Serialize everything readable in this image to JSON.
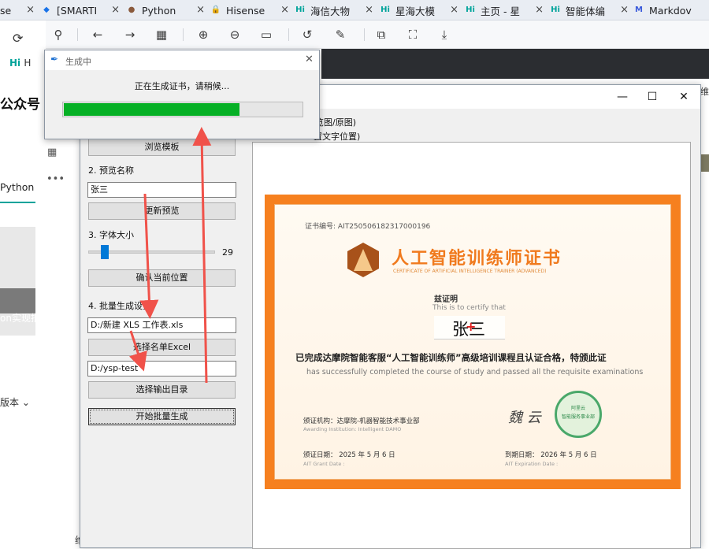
{
  "browser": {
    "tabs": [
      {
        "label": "se",
        "icon": "page-icon",
        "color": "#555"
      },
      {
        "label": "[SMARTI",
        "icon": "diamond-icon",
        "color": "#1a73e8"
      },
      {
        "label": "Python",
        "icon": "avatar-icon",
        "color": "#8a5a3c"
      },
      {
        "label": "Hisense",
        "icon": "lock-icon",
        "color": "#2b5fb3"
      },
      {
        "label": "海信大物",
        "icon": "hi-icon",
        "color": "#00a39a"
      },
      {
        "label": "星海大模",
        "icon": "hi-icon",
        "color": "#00a39a"
      },
      {
        "label": "主页 - 星",
        "icon": "hi-icon",
        "color": "#00a39a"
      },
      {
        "label": "智能体编",
        "icon": "hi-icon",
        "color": "#00a39a"
      },
      {
        "label": "Markdov",
        "icon": "m-icon",
        "color": "#3b5bdb"
      }
    ],
    "close_glyph": "×"
  },
  "left_page": {
    "hi_brand": "Hi",
    "hi_letter": "H",
    "title_fragment": "公众号",
    "tab_fragment": "Python",
    "banner_fragment": "on实现批",
    "version_fragment": "版本",
    "bottom_fragment": "维"
  },
  "dialog": {
    "title": "生成中",
    "message": "正在生成证书，请稍候...",
    "progress": 0.74
  },
  "app": {
    "window_controls": {
      "minimize": "—",
      "maximize": "☐",
      "close": "✕"
    },
    "radio_fragment_1": "览图/原图)",
    "radio_fragment_2": "置文字位置)",
    "browse_template": "浏览模板",
    "section_preview_name": "2. 预览名称",
    "preview_name_value": "张三",
    "update_preview": "更新预览",
    "section_font_size": "3. 字体大小",
    "font_size_value": "29",
    "font_size_fraction": 0.1,
    "confirm_position": "确认当前位置",
    "section_batch": "4. 批量生成设置",
    "excel_path": "D:/新建 XLS 工作表.xls",
    "select_excel": "选择名单Excel",
    "output_path": "D:/ysp-test",
    "select_output": "选择输出目录",
    "start_batch": "开始批量生成"
  },
  "certificate": {
    "cert_no": "证书编号:  AIT250506182317000196",
    "title_cn": "人工智能训练师证书",
    "title_en": "CERTIFICATE OF ARTIFICIAL INTELLIGENCE TRAINER (ADVANCED)",
    "certify_cn": "兹证明",
    "certify_en": "This is to certify that",
    "name": "张三",
    "body_cn": "已完成达摩院智能客服“人工智能训练师”高级培训课程且认证合格，特颁此证",
    "body_en": "has successfully completed the course of study and passed all the requisite examinations",
    "issuer_cn": "颁证机构：达摩院-机器智能技术事业部",
    "issuer_en": "Awarding Institution: Intelligent DAMO",
    "signature": "魏 云",
    "seal_text_top": "阿里云",
    "seal_text_mid": "智能服务事业部",
    "grant_date_cn": "颁证日期：   2025 年  5  月  6  日",
    "grant_date_en": "AIT Grant Date :",
    "expire_date_cn": "到期日期：   2026 年  5  月  6  日",
    "expire_date_en": "AIT Expiration Date :",
    "accent_color": "#f6801f"
  }
}
